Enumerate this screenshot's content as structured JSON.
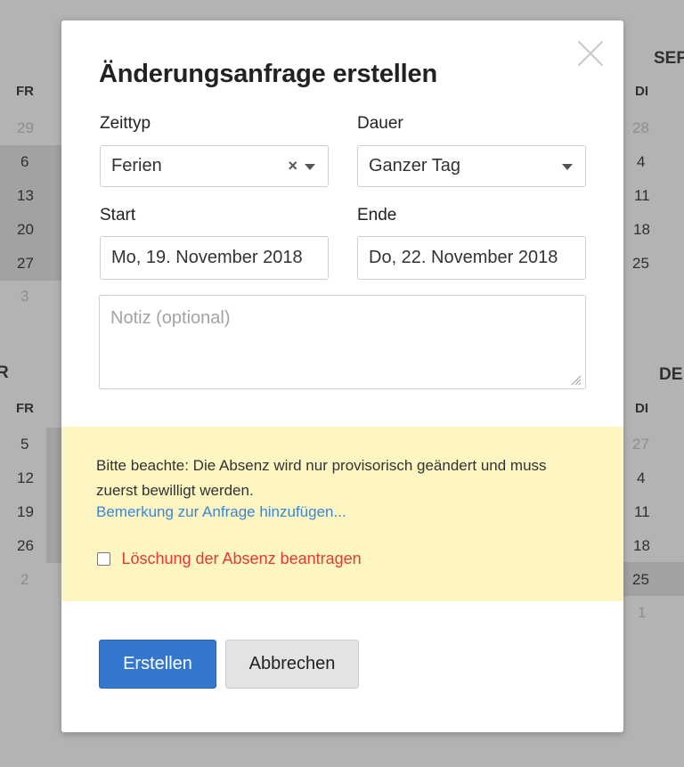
{
  "background": {
    "left_month_partial": "R",
    "right_month_top": "SEP",
    "right_month_bottom": "DE",
    "left_head_top": "FR",
    "left_head_bottom": "FR",
    "right_head_top": "DI",
    "right_head_bottom": "DI",
    "left_top_days": [
      "29",
      "6",
      "13",
      "20",
      "27",
      "3"
    ],
    "left_bottom_days": [
      "5",
      "12",
      "19",
      "26",
      "2"
    ],
    "right_top_days": [
      "28",
      "4",
      "11",
      "18",
      "25"
    ],
    "right_bottom_days": [
      "27",
      "4",
      "11",
      "18",
      "25",
      "1"
    ]
  },
  "modal": {
    "title": "Änderungsanfrage erstellen",
    "time_type": {
      "label": "Zeittyp",
      "value": "Ferien"
    },
    "duration": {
      "label": "Dauer",
      "value": "Ganzer Tag"
    },
    "start": {
      "label": "Start",
      "value": "Mo, 19. November 2018"
    },
    "end": {
      "label": "Ende",
      "value": "Do, 22. November 2018"
    },
    "note": {
      "placeholder": "Notiz (optional)"
    },
    "notice": {
      "text": "Bitte beachte: Die Absenz wird nur provisorisch geändert und muss zuerst bewilligt werden.",
      "link": "Bemerkung zur Anfrage hinzufügen...",
      "delete_label": "Löschung der Absenz beantragen"
    },
    "buttons": {
      "create": "Erstellen",
      "cancel": "Abbrechen"
    }
  }
}
